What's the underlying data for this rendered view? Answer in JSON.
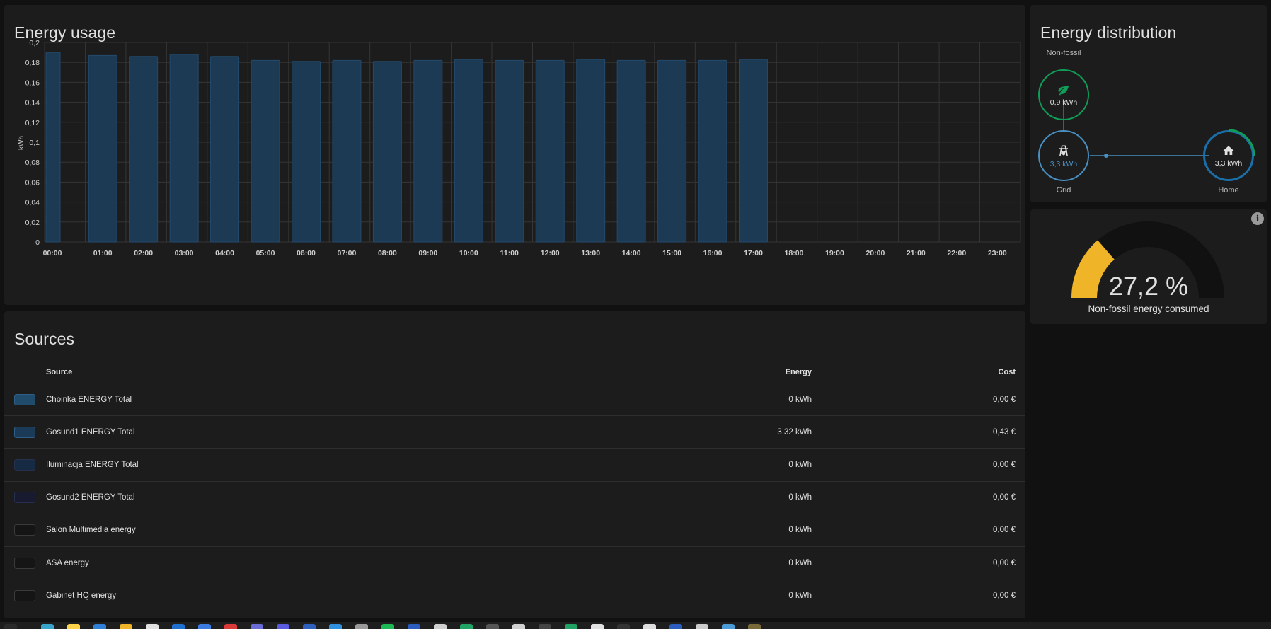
{
  "usage_card": {
    "title": "Energy usage"
  },
  "chart_data": {
    "type": "bar",
    "ylabel": "kWh",
    "ylim": [
      0,
      0.2
    ],
    "yticks": [
      "0",
      "0,02",
      "0,04",
      "0,06",
      "0,08",
      "0,1",
      "0,12",
      "0,14",
      "0,16",
      "0,18",
      "0,2"
    ],
    "categories": [
      "00:00",
      "01:00",
      "02:00",
      "03:00",
      "04:00",
      "05:00",
      "06:00",
      "07:00",
      "08:00",
      "09:00",
      "10:00",
      "11:00",
      "12:00",
      "13:00",
      "14:00",
      "15:00",
      "16:00",
      "17:00",
      "18:00",
      "19:00",
      "20:00",
      "21:00",
      "22:00",
      "23:00"
    ],
    "values": [
      0.19,
      0.187,
      0.186,
      0.188,
      0.186,
      0.182,
      0.181,
      0.182,
      0.181,
      0.182,
      0.183,
      0.182,
      0.182,
      0.183,
      0.182,
      0.182,
      0.182,
      0.183,
      null,
      null,
      null,
      null,
      null,
      null
    ],
    "bar_color": "#1d3a55",
    "grid": true
  },
  "sources_card": {
    "title": "Sources",
    "headers": {
      "source": "Source",
      "energy": "Energy",
      "cost": "Cost"
    },
    "rows": [
      {
        "name": "Choinka ENERGY Total",
        "energy": "0 kWh",
        "cost": "0,00 €",
        "color": "#204b6b"
      },
      {
        "name": "Gosund1 ENERGY Total",
        "energy": "3,32 kWh",
        "cost": "0,43 €",
        "color": "#1a3a57"
      },
      {
        "name": "Iluminacja ENERGY Total",
        "energy": "0 kWh",
        "cost": "0,00 €",
        "color": "#172a43"
      },
      {
        "name": "Gosund2 ENERGY Total",
        "energy": "0 kWh",
        "cost": "0,00 €",
        "color": "#181a30"
      },
      {
        "name": "Salon Multimedia energy",
        "energy": "0 kWh",
        "cost": "0,00 €",
        "color": "#151515"
      },
      {
        "name": "ASA energy",
        "energy": "0 kWh",
        "cost": "0,00 €",
        "color": "#151515"
      },
      {
        "name": "Gabinet HQ energy",
        "energy": "0 kWh",
        "cost": "0,00 €",
        "color": "#151515"
      }
    ]
  },
  "distribution_card": {
    "title": "Energy distribution",
    "non_fossil": {
      "label": "Non-fossil",
      "value": "0,9 kWh",
      "icon": "leaf-icon",
      "color": "#0f9d58"
    },
    "grid": {
      "label": "Grid",
      "value": "3,3 kWh",
      "icon": "transmission-tower-icon",
      "color": "#488fc2"
    },
    "home": {
      "label": "Home",
      "value": "3,3 kWh",
      "icon": "home-icon",
      "color": "#1b6fa8"
    }
  },
  "gauge_card": {
    "value_text": "27,2 %",
    "value": 27.2,
    "label": "Non-fossil energy consumed",
    "color": "#f0b429",
    "icon": "info-icon"
  },
  "taskbar": {
    "icons": [
      "windows-icon",
      "search-icon",
      "folder-icon",
      "edge-icon",
      "files-icon",
      "phone-icon",
      "shield-icon",
      "outlook-icon",
      "chrome-icon",
      "discord-icon",
      "notepad-icon",
      "word-icon",
      "vscode-icon",
      "terminal-icon",
      "spotify-icon",
      "calc-icon",
      "teams-icon",
      "excel-icon",
      "obs-icon",
      "settings-icon",
      "console-icon",
      "sheets-icon",
      "clock-icon",
      "app-icon",
      "notes-icon",
      "mail-icon",
      "pen-icon",
      "box-icon",
      "player-icon"
    ]
  }
}
